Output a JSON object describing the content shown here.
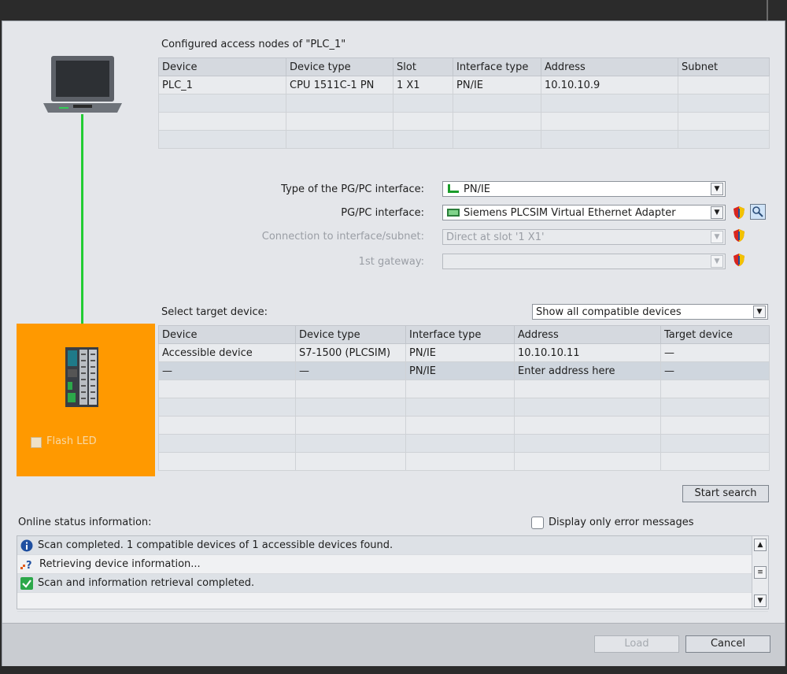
{
  "configured": {
    "heading": "Configured access nodes of \"PLC_1\"",
    "columns": [
      "Device",
      "Device type",
      "Slot",
      "Interface type",
      "Address",
      "Subnet"
    ],
    "rows": [
      [
        "PLC_1",
        "CPU 1511C-1 PN",
        "1 X1",
        "PN/IE",
        "10.10.10.9",
        ""
      ],
      [
        "",
        "",
        "",
        "",
        "",
        ""
      ],
      [
        "",
        "",
        "",
        "",
        "",
        ""
      ],
      [
        "",
        "",
        "",
        "",
        "",
        ""
      ]
    ]
  },
  "pgpc": {
    "type_label": "Type of the PG/PC interface:",
    "type_value": "PN/IE",
    "interface_label": "PG/PC interface:",
    "interface_value": "Siemens PLCSIM Virtual Ethernet Adapter",
    "connection_label": "Connection to interface/subnet:",
    "connection_value": "Direct at slot '1 X1'",
    "gateway_label": "1st gateway:",
    "gateway_value": ""
  },
  "target": {
    "heading": "Select target device:",
    "filter_value": "Show all compatible devices",
    "columns": [
      "Device",
      "Device type",
      "Interface type",
      "Address",
      "Target device"
    ],
    "rows": [
      [
        "Accessible device",
        "S7-1500 (PLCSIM)",
        "PN/IE",
        "10.10.10.11",
        "—"
      ],
      [
        "—",
        "—",
        "PN/IE",
        "Enter address here",
        "—"
      ],
      [
        "",
        "",
        "",
        "",
        ""
      ],
      [
        "",
        "",
        "",
        "",
        ""
      ],
      [
        "",
        "",
        "",
        "",
        ""
      ],
      [
        "",
        "",
        "",
        "",
        ""
      ],
      [
        "",
        "",
        "",
        "",
        ""
      ]
    ]
  },
  "flash_led_label": "Flash LED",
  "start_search_label": "Start search",
  "online": {
    "heading": "Online status information:",
    "error_only_label": "Display only error messages",
    "messages": [
      {
        "icon": "info-icon",
        "text": "Scan completed. 1 compatible devices of 1 accessible devices found."
      },
      {
        "icon": "retrieve-icon",
        "text": "Retrieving device information..."
      },
      {
        "icon": "check-icon",
        "text": "Scan and information retrieval completed."
      },
      {
        "icon": "",
        "text": ""
      }
    ]
  },
  "buttons": {
    "load": "Load",
    "cancel": "Cancel"
  },
  "colors": {
    "accent_orange": "#ff9900",
    "link_green": "#22cc33"
  }
}
